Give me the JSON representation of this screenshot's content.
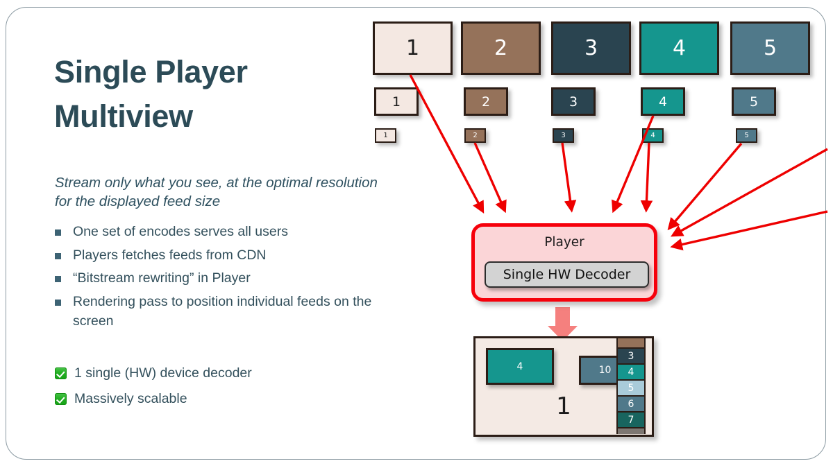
{
  "slide": {
    "title_line1": "Single Player",
    "title_line2": "Multiview",
    "subtitle": "Stream only what you see, at the optimal resolution for the displayed feed size",
    "bullets": [
      "One set of encodes serves all users",
      "Players fetches feeds from CDN",
      "“Bitstream rewriting” in Player",
      "Rendering pass to position individual feeds on the screen"
    ],
    "checks": [
      "1 single (HW) device decoder",
      "Massively scalable"
    ]
  },
  "colors": {
    "title": "#2c4b57",
    "bullet_square": "#3d6374",
    "check_green": "#22b022",
    "arrow_red": "#ee0000",
    "arrow_pink": "#f5807e",
    "player_fill": "#fbd5d7",
    "player_border": "#f6000b",
    "decoder_fill": "#d3d3d3",
    "screen_fill": "#f4eae4",
    "tile_border": "#2b1d16",
    "feed1": "#f4e8e2",
    "feed2": "#95725a",
    "feed3": "#2a4450",
    "feed4": "#15968e",
    "feed5": "#50798a",
    "strip_brown": "#95725a",
    "strip_light_blue": "#a9cbd9",
    "strip_gray": "#7d7772"
  },
  "feeds": {
    "large": [
      {
        "label": "1",
        "color": "#f4e8e2",
        "text": "#1c1c1c"
      },
      {
        "label": "2",
        "color": "#95725a",
        "text": "#ffffff"
      },
      {
        "label": "3",
        "color": "#2a4450",
        "text": "#ffffff"
      },
      {
        "label": "4",
        "color": "#15968e",
        "text": "#ffffff"
      },
      {
        "label": "5",
        "color": "#50798a",
        "text": "#ffffff"
      }
    ],
    "medium": [
      {
        "label": "1",
        "color": "#f4e8e2",
        "text": "#1c1c1c"
      },
      {
        "label": "2",
        "color": "#95725a",
        "text": "#ffffff"
      },
      {
        "label": "3",
        "color": "#2a4450",
        "text": "#ffffff"
      },
      {
        "label": "4",
        "color": "#15968e",
        "text": "#ffffff"
      },
      {
        "label": "5",
        "color": "#50798a",
        "text": "#ffffff"
      }
    ],
    "small": [
      {
        "label": "1",
        "color": "#f4e8e2",
        "text": "#1c1c1c"
      },
      {
        "label": "2",
        "color": "#95725a",
        "text": "#ffffff"
      },
      {
        "label": "3",
        "color": "#2a4450",
        "text": "#ffffff"
      },
      {
        "label": "4",
        "color": "#15968e",
        "text": "#ffffff"
      },
      {
        "label": "5",
        "color": "#50798a",
        "text": "#ffffff"
      }
    ]
  },
  "player": {
    "title": "Player",
    "decoder_label": "Single HW  Decoder"
  },
  "screen": {
    "main_number": "1",
    "tiles": [
      {
        "label": "4",
        "color": "#15968e"
      },
      {
        "label": "10",
        "color": "#50798a"
      }
    ],
    "sidebar": [
      {
        "label": "",
        "color": "#95725a"
      },
      {
        "label": "3",
        "color": "#2a4450"
      },
      {
        "label": "4",
        "color": "#15968e"
      },
      {
        "label": "5",
        "color": "#a9cbd9"
      },
      {
        "label": "6",
        "color": "#50798a"
      },
      {
        "label": "7",
        "color": "#18655f"
      },
      {
        "label": "",
        "color": "#7d7772"
      }
    ]
  }
}
